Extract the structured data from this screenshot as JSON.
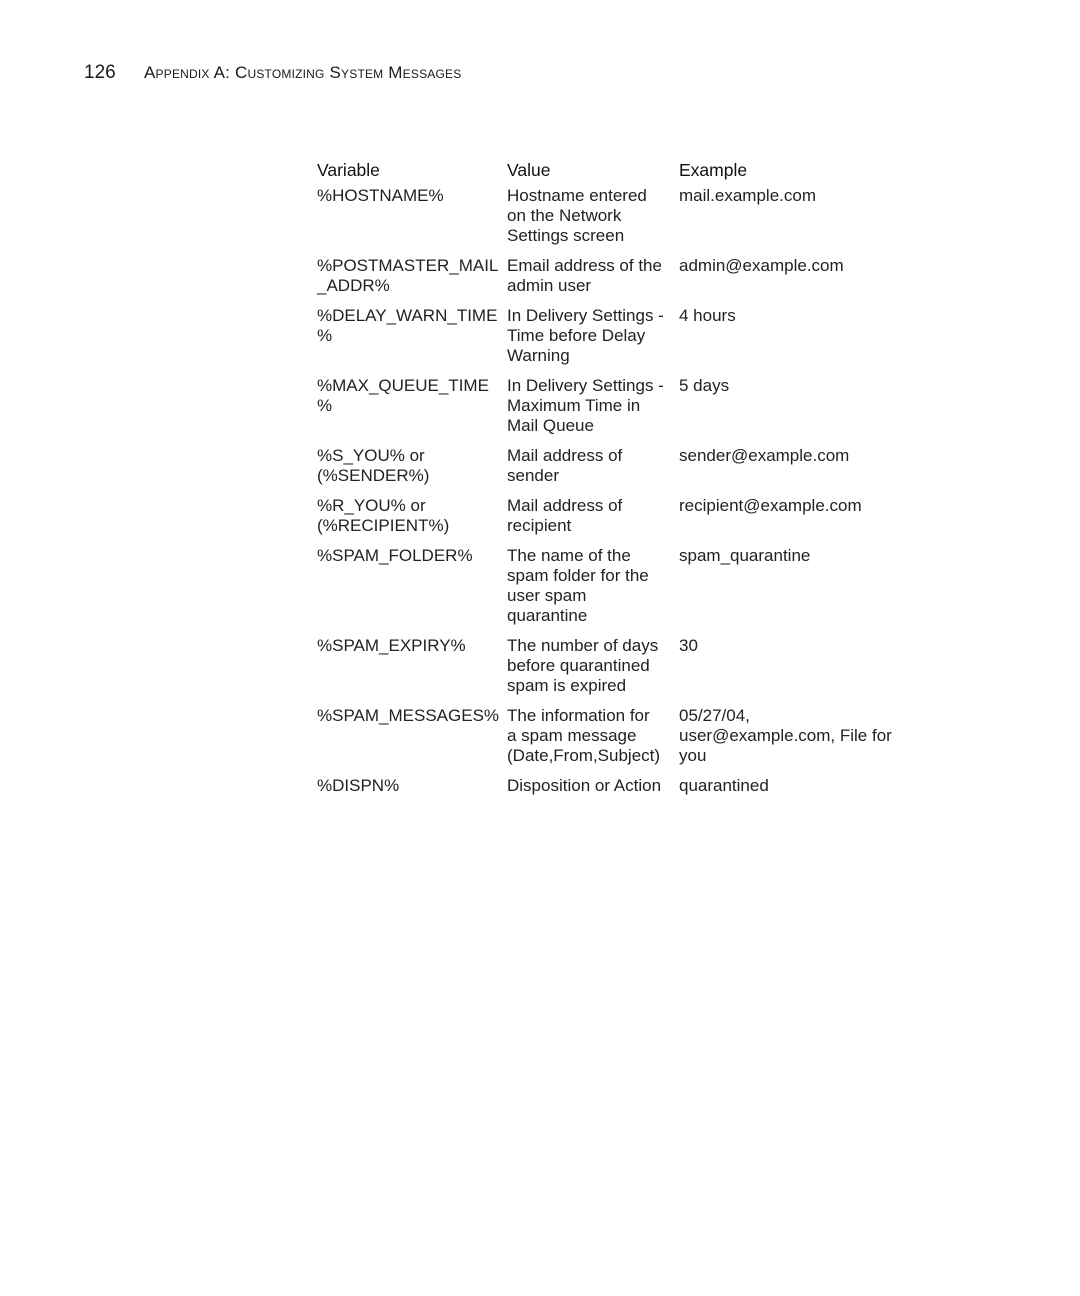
{
  "header": {
    "page_number": "126",
    "section_title": "Appendix A: Customizing System Messages"
  },
  "table": {
    "columns": [
      "Variable",
      "Value",
      "Example"
    ],
    "rows": [
      {
        "variable": "%HOSTNAME%",
        "value": "Hostname entered\non the Network\nSettings screen",
        "example": "mail.example.com"
      },
      {
        "variable": "%POSTMASTER_MAIL\n_ADDR%",
        "value": "Email address of the\nadmin user",
        "example": "admin@example.com"
      },
      {
        "variable": "%DELAY_WARN_TIME\n%",
        "value": "In Delivery Settings -\nTime before Delay\nWarning",
        "example": "4 hours"
      },
      {
        "variable": "%MAX_QUEUE_TIME\n%",
        "value": "In Delivery Settings -\nMaximum Time in\nMail Queue",
        "example": "5 days"
      },
      {
        "variable": "%S_YOU% or\n(%SENDER%)",
        "value": "Mail address of\nsender",
        "example": "sender@example.com"
      },
      {
        "variable": "%R_YOU% or\n(%RECIPIENT%)",
        "value": "Mail address of\nrecipient",
        "example": "recipient@example.com"
      },
      {
        "variable": "%SPAM_FOLDER%",
        "value": "The name of the\nspam folder for the\nuser spam\nquarantine",
        "example": "spam_quarantine"
      },
      {
        "variable": "%SPAM_EXPIRY%",
        "value": "The number of days\nbefore quarantined\nspam is expired",
        "example": "30"
      },
      {
        "variable": "%SPAM_MESSAGES%",
        "value": "The information for\na spam message\n(Date,From,Subject)",
        "example": "05/27/04,\nuser@example.com, File for\nyou"
      },
      {
        "variable": "%DISPN%",
        "value": "Disposition or Action",
        "example": "quarantined"
      }
    ]
  }
}
